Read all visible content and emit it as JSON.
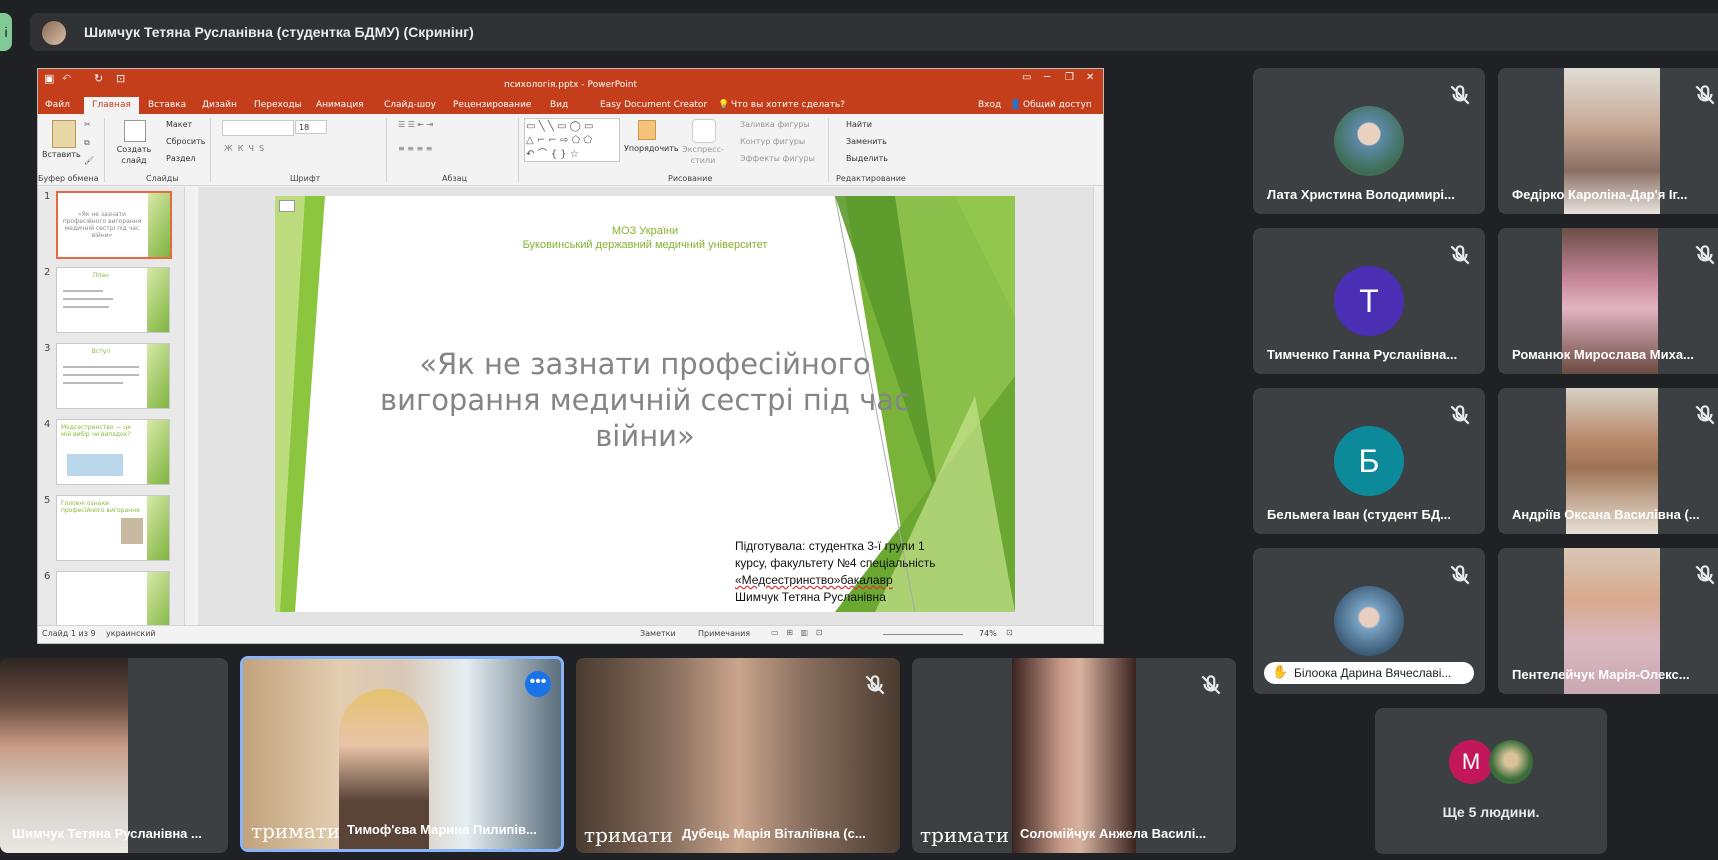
{
  "meet": {
    "edge_label": "і",
    "presenter_title": "Шимчук Тетяна Русланівна (студентка БДМУ) (Скринінг)",
    "colors": {
      "bg": "#202124",
      "tile": "#3c4043",
      "accent": "#81c995",
      "highlight": "#8ab4f8"
    },
    "right_tiles": [
      {
        "name": "Лата Христина Володимирі...",
        "kind": "photo-avatar",
        "muted": true
      },
      {
        "name": "Федірко Кароліна-Дар'я Іг...",
        "kind": "video",
        "muted": true
      },
      {
        "name": "Тимченко Ганна Русланівна...",
        "kind": "letter",
        "letter": "Т",
        "color": "#4a2fb5",
        "muted": true
      },
      {
        "name": "Романюк Мирослава Миха...",
        "kind": "video",
        "muted": true
      },
      {
        "name": "Бельмега Іван (студент БД...",
        "kind": "letter",
        "letter": "Б",
        "color": "#0d8a9a",
        "muted": true
      },
      {
        "name": "Андріїв Оксана Василівна (...",
        "kind": "video",
        "muted": true
      },
      {
        "name": "Білоока Дарина Вячеславі...",
        "kind": "photo-avatar",
        "muted": true,
        "hand_raised": true
      },
      {
        "name": "Пентелейчук Марія-Олекс...",
        "kind": "video",
        "muted": true
      }
    ],
    "more": {
      "label": "Ще 5 людини.",
      "letter": "М",
      "color": "#c2185b"
    },
    "bottom_tiles": [
      {
        "name": "Шимчук Тетяна Русланівна ...",
        "hold": "",
        "muted": false
      },
      {
        "name": "Тимоф'єва Марина Пилипів...",
        "hold": "тримати",
        "muted": false,
        "active": true
      },
      {
        "name": "Дубець Марія Віталіївна (с...",
        "hold": "тримати",
        "muted": true
      },
      {
        "name": "Соломійчук Анжела Василі...",
        "hold": "тримати",
        "muted": true
      }
    ]
  },
  "ppt": {
    "window_title": "психологія.pptx - PowerPoint",
    "tabs": [
      "Файл",
      "Главная",
      "Вставка",
      "Дизайн",
      "Переходы",
      "Анимация",
      "Слайд-шоу",
      "Рецензирование",
      "Вид",
      "Easy Document Creator"
    ],
    "tell_me": "Что вы хотите сделать?",
    "signin": "Вход",
    "share": "Общий доступ",
    "ribbon": {
      "paste": "Вставить",
      "clipboard_group": "Буфер обмена",
      "new_slide": "Создать слайд",
      "layout": "Макет",
      "reset": "Сбросить",
      "section": "Раздел",
      "slides_group": "Слайды",
      "font_group": "Шрифт",
      "font_size": "18",
      "paragraph_group": "Абзац",
      "arrange": "Упорядочить",
      "quick_styles": "Экспресс-стили",
      "fill": "Заливка фигуры",
      "outline": "Контур фигуры",
      "effects": "Эффекты фигуры",
      "drawing_group": "Рисование",
      "find": "Найти",
      "replace": "Заменить",
      "select": "Выделить",
      "editing_group": "Редактирование"
    },
    "thumbnails": [
      {
        "num": "1",
        "title": "«Як не зазнати професійного вигорання медичній сестрі під час війни»"
      },
      {
        "num": "2",
        "title": "План"
      },
      {
        "num": "3",
        "title": "Вступ"
      },
      {
        "num": "4",
        "title": "Медсестринство — це мій вибір чи випадок?"
      },
      {
        "num": "5",
        "title": "Головні ознаки професійного вигорання"
      },
      {
        "num": "6",
        "title": ""
      }
    ],
    "slide": {
      "org_line1": "МОЗ України",
      "org_line2": "Буковинський державний медичний університет",
      "title": "«Як не зазнати професійного вигорання медичній сестрі під час війни»",
      "author_line1": "Підготувала: студентка 3-ї групи 1",
      "author_line2": "курсу, факультету №4 спеціальність",
      "author_line3": "«Медсестринство»бакалавр",
      "author_line4": "Шимчук Тетяна Русланівна"
    },
    "status": {
      "slide_info": "Слайд 1 из 9",
      "language": "украинский",
      "notes": "Заметки",
      "comments": "Примечания",
      "zoom": "74%"
    }
  }
}
